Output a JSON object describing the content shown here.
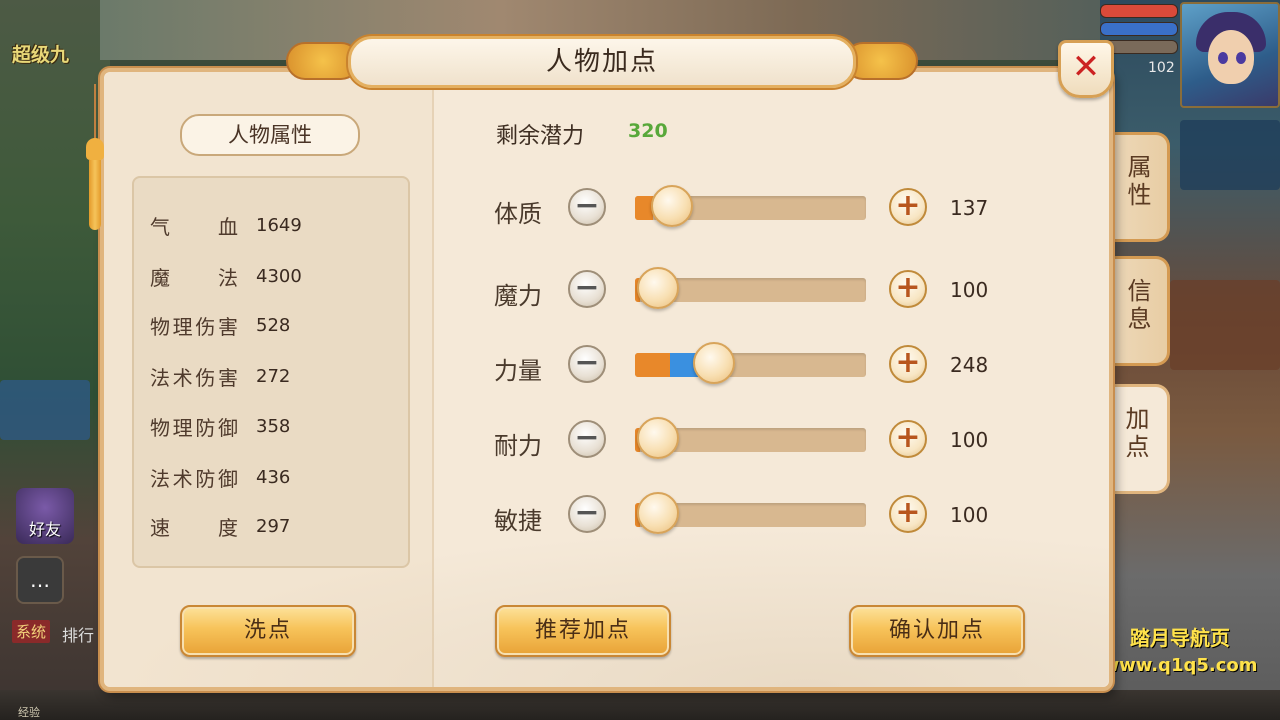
{
  "hud": {
    "player_name": "超级九",
    "level": "102",
    "hp_color": "#d94a3a",
    "mp_color": "#3a70c8",
    "friend_label": "好友",
    "system_tag": "系统",
    "rank_text": "排行",
    "exp_label": "经验"
  },
  "watermark": {
    "line1": "踏月导航页",
    "line2": "www.q1q5.com"
  },
  "panel": {
    "title": "人物加点",
    "close_icon": "close-icon"
  },
  "attributes": {
    "header": "人物属性",
    "rows": [
      {
        "label": "气血",
        "value": "1649"
      },
      {
        "label": "魔法",
        "value": "4300"
      },
      {
        "label": "物理伤害",
        "value": "528"
      },
      {
        "label": "法术伤害",
        "value": "272"
      },
      {
        "label": "物理防御",
        "value": "358"
      },
      {
        "label": "法术防御",
        "value": "436"
      },
      {
        "label": "速度",
        "value": "297"
      }
    ],
    "reset_button": "洗点"
  },
  "allocation": {
    "potential_label": "剩余潜力",
    "potential_value": "320",
    "stats": [
      {
        "name": "体质",
        "value": "137",
        "base_fill": 0.08,
        "extra_fill": 0.0,
        "knob": 0.16
      },
      {
        "name": "魔力",
        "value": "100",
        "base_fill": 0.02,
        "extra_fill": 0.0,
        "knob": 0.1
      },
      {
        "name": "力量",
        "value": "248",
        "base_fill": 0.15,
        "extra_fill": 0.12,
        "knob": 0.34
      },
      {
        "name": "耐力",
        "value": "100",
        "base_fill": 0.02,
        "extra_fill": 0.0,
        "knob": 0.1
      },
      {
        "name": "敏捷",
        "value": "100",
        "base_fill": 0.02,
        "extra_fill": 0.0,
        "knob": 0.1
      }
    ],
    "minus_symbol": "−",
    "plus_symbol": "+",
    "recommend_button": "推荐加点",
    "confirm_button": "确认加点"
  },
  "side_tabs": [
    {
      "label": "属性",
      "active": false
    },
    {
      "label": "信息",
      "active": false
    },
    {
      "label": "加点",
      "active": true
    }
  ]
}
